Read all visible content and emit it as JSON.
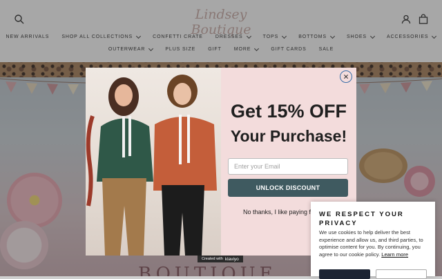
{
  "header": {
    "logo_text": "Lindsey Boutique",
    "nav_row1": [
      {
        "label": "NEW ARRIVALS",
        "has_dropdown": false
      },
      {
        "label": "SHOP ALL COLLECTIONS",
        "has_dropdown": true
      },
      {
        "label": "CONFETTI CRATE",
        "has_dropdown": false
      },
      {
        "label": "DRESSES",
        "has_dropdown": true
      },
      {
        "label": "TOPS",
        "has_dropdown": true
      },
      {
        "label": "BOTTOMS",
        "has_dropdown": true
      },
      {
        "label": "SHOES",
        "has_dropdown": true
      },
      {
        "label": "ACCESSORIES",
        "has_dropdown": true
      }
    ],
    "nav_row2": [
      {
        "label": "OUTERWEAR",
        "has_dropdown": true
      },
      {
        "label": "PLUS SIZE",
        "has_dropdown": false
      },
      {
        "label": "GIFT",
        "has_dropdown": false
      },
      {
        "label": "MORE",
        "has_dropdown": true
      },
      {
        "label": "GIFT CARDS",
        "has_dropdown": false
      },
      {
        "label": "SALE",
        "has_dropdown": false
      }
    ],
    "icons": [
      "search-icon",
      "account-icon",
      "cart-icon"
    ]
  },
  "hero": {
    "text": "BOUTIQUE"
  },
  "popup": {
    "headline_1": "Get 15% OFF",
    "headline_2": "Your Purchase!",
    "email_placeholder": "Enter your Email",
    "unlock_label": "UNLOCK DISCOUNT",
    "decline_label": "No thanks, I like paying f",
    "klaviyo_prefix": "Created with",
    "klaviyo_brand": "klaviyo"
  },
  "cookie": {
    "title": "WE RESPECT YOUR PRIVACY",
    "body": "We use cookies to help deliver the best experience and allow us, and third parties, to optimise content for you. By continuing, you agree to our cookie policy.",
    "link": "Learn more"
  },
  "colors": {
    "unlock_button": "#3f5a60",
    "popup_background": "#f3dcdc",
    "cookie_button": "#1c2433"
  }
}
